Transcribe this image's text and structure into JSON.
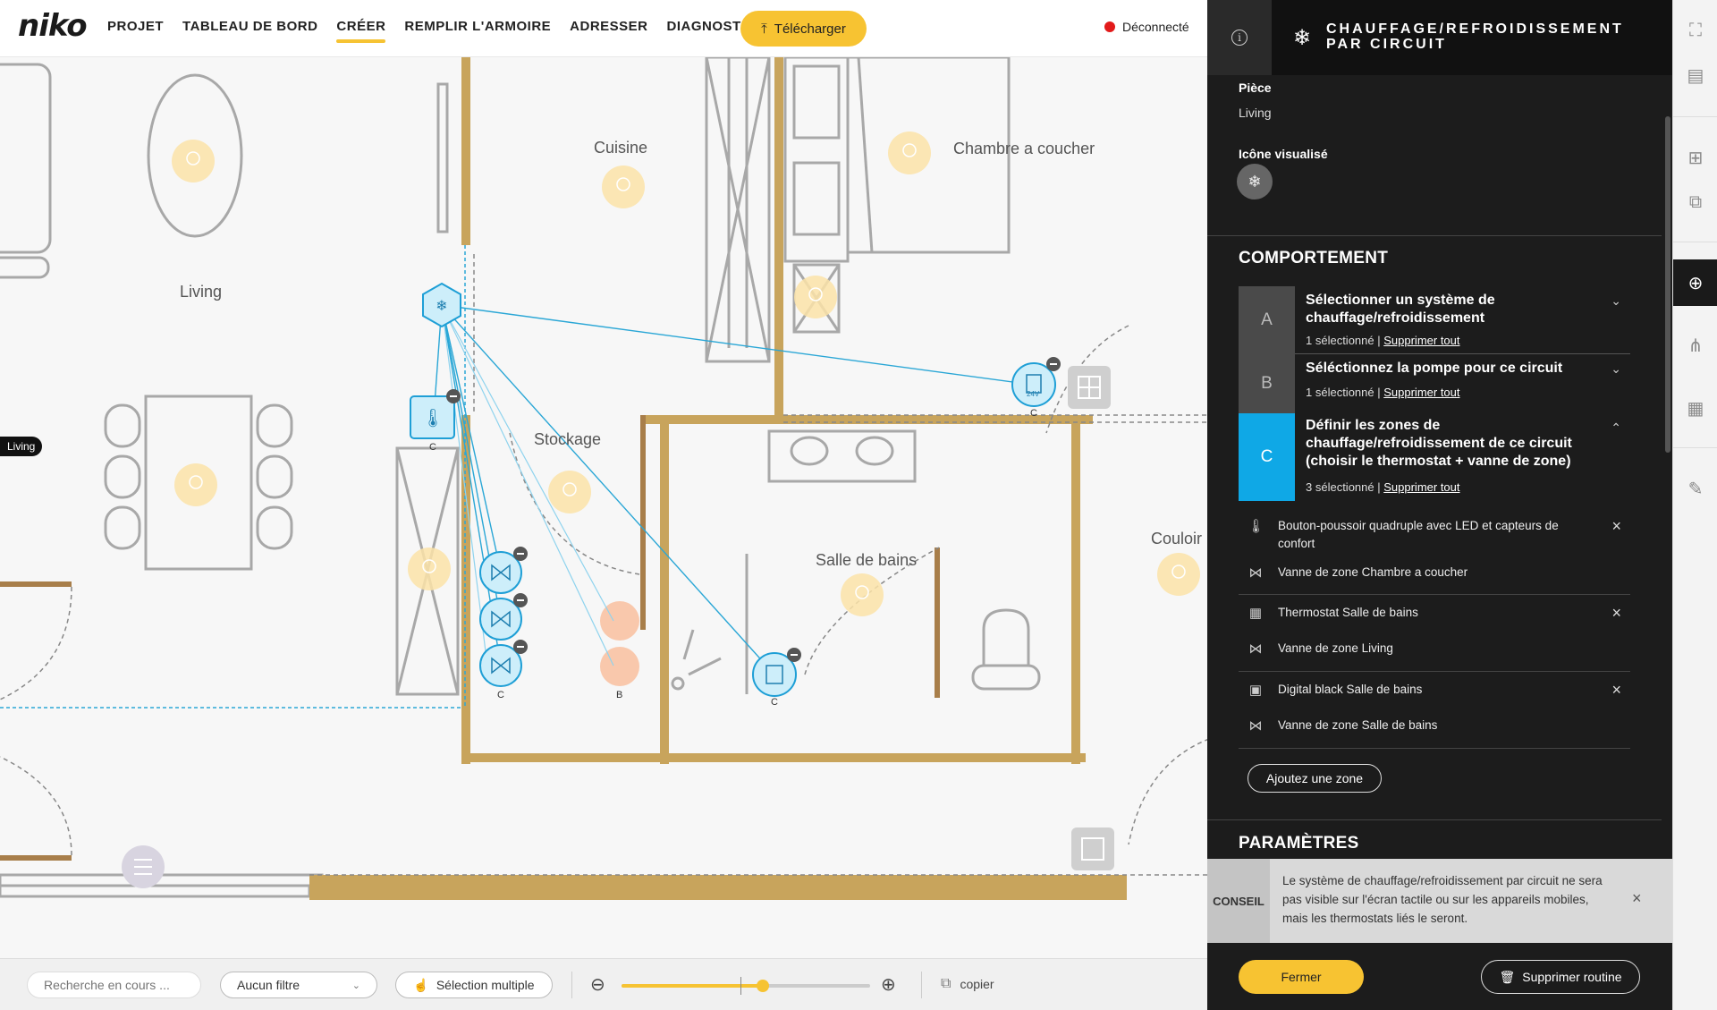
{
  "app": {
    "logo": "niko"
  },
  "nav": {
    "items": [
      {
        "label": "PROJET",
        "active": false
      },
      {
        "label": "TABLEAU DE BORD",
        "active": false
      },
      {
        "label": "CRÉER",
        "active": true
      },
      {
        "label": "REMPLIR L'ARMOIRE",
        "active": false
      },
      {
        "label": "ADRESSER",
        "active": false
      },
      {
        "label": "DIAGNOSTIC",
        "active": false,
        "external": true
      }
    ],
    "download_label": "Télécharger",
    "status_label": "Déconnecté",
    "status_color": "#e21a1a",
    "accent_color": "#f7c332"
  },
  "floorplan": {
    "rooms": {
      "living": "Living",
      "cuisine": "Cuisine",
      "chambre": "Chambre a coucher",
      "stockage": "Stockage",
      "salle_de_bains": "Salle de bains",
      "couloir": "Couloir"
    },
    "room_tag": "Living",
    "device_letters": {
      "thermostat": "C",
      "valve_b": "B",
      "display": "C",
      "touch": "C",
      "valve_c": "C"
    },
    "touch_label": "24V"
  },
  "bottombar": {
    "search_placeholder": "Recherche en cours ...",
    "filter_label": "Aucun filtre",
    "multi_select_label": "Sélection multiple",
    "zoom_level": 0.57,
    "copy_label": "copier"
  },
  "panel": {
    "title": "CHAUFFAGE/REFROIDISSEMENT PAR CIRCUIT",
    "room_label": "Pièce",
    "room_value": "Living",
    "icon_label": "Icône visualisé",
    "behavior_title": "COMPORTEMENT",
    "steps": [
      {
        "letter": "A",
        "title": "Sélectionner un système de chauffage/refroidissement",
        "count": "1 sélectionné",
        "remove": "Supprimer tout",
        "expanded": false
      },
      {
        "letter": "B",
        "title": "Séléctionnez la pompe pour ce circuit",
        "count": "1 sélectionné",
        "remove": "Supprimer tout",
        "expanded": false
      },
      {
        "letter": "C",
        "title": "Définir les zones de chauffage/refroidissement de ce circuit (choisir le thermostat + vanne de zone)",
        "count": "3 sélectionné",
        "remove": "Supprimer tout",
        "expanded": true
      }
    ],
    "zones": [
      {
        "thermostat": "Bouton-poussoir quadruple avec LED et capteurs de confort",
        "valve": "Vanne de zone Chambre a coucher",
        "thermostat_icon": "thermometer-icon"
      },
      {
        "thermostat": "Thermostat Salle de bains",
        "valve": "Vanne de zone Living",
        "thermostat_icon": "thermostat-icon"
      },
      {
        "thermostat": "Digital black Salle de bains",
        "valve": "Vanne de zone Salle de bains",
        "thermostat_icon": "touch-display-icon"
      }
    ],
    "add_zone_label": "Ajoutez une zone",
    "params_title": "PARAMÈTRES",
    "tip_label": "CONSEIL",
    "tip_text": "Le système de chauffage/refroidissement par circuit ne sera pas visible sur l'écran tactile ou sur les appareils mobiles, mais les thermostats liés le seront.",
    "close_label": "Fermer",
    "delete_label": "Supprimer routine",
    "step_active_color": "#0fa8e6"
  }
}
